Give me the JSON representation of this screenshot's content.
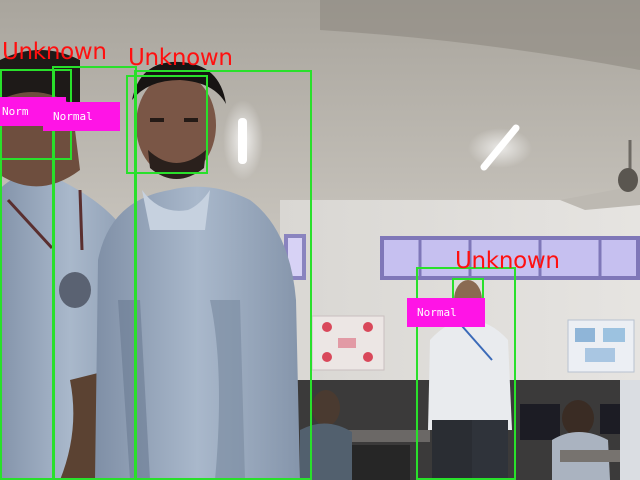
{
  "frame": {
    "detections": [
      {
        "identity": "Unknown",
        "status": "Norm"
      },
      {
        "identity": "Unknown",
        "status": "Normal"
      },
      {
        "identity": "Unknown",
        "status": "Normal"
      }
    ]
  },
  "colors": {
    "box": "#29e02b",
    "identity_text": "#ff1010",
    "status_badge": "#ff14e6",
    "status_text": "#ffffff"
  }
}
